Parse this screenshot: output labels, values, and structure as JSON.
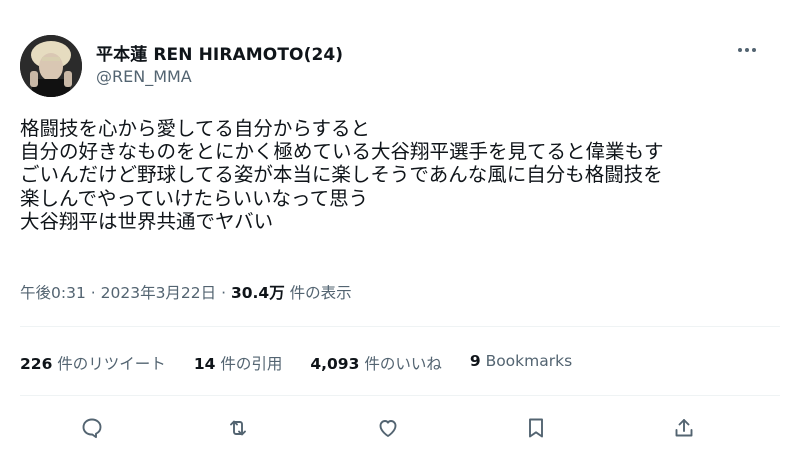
{
  "author": {
    "display_name": "平本蓮 REN HIRAMOTO(24)",
    "handle": "@REN_MMA",
    "avatar_icon": "profile-photo"
  },
  "more_icon": "more-horizontal-icon",
  "tweet_text": [
    "格闘技を心から愛してる自分からすると",
    "自分の好きなものをとにかく極めている大谷翔平選手を見てると偉業もす",
    "ごいんだけど野球してる姿が本当に楽しそうであんな風に自分も格闘技を",
    "楽しんでやっていけたらいいなって思う",
    "大谷翔平は世界共通でヤバい"
  ],
  "meta": {
    "time": "午後0:31",
    "separator": "·",
    "date": "2023年3月22日",
    "views_count": "30.4万",
    "views_label": "件の表示"
  },
  "stats": {
    "retweets_count": "226",
    "retweets_label": "件のリツイート",
    "quotes_count": "14",
    "quotes_label": "件の引用",
    "likes_count": "4,093",
    "likes_label": "件のいいね",
    "bookmarks_count": "9",
    "bookmarks_label": "Bookmarks"
  },
  "actions": [
    {
      "name": "reply-icon"
    },
    {
      "name": "retweet-icon"
    },
    {
      "name": "like-icon"
    },
    {
      "name": "bookmark-icon"
    },
    {
      "name": "share-icon"
    }
  ],
  "colors": {
    "text": "#0f1419",
    "secondary": "#536471",
    "divider": "#eff3f4"
  }
}
